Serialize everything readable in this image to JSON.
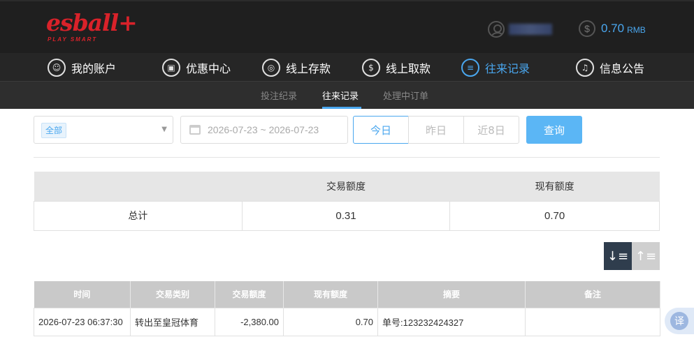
{
  "brand": {
    "logo_main": "esball+",
    "logo_sub": "PLAY SMART"
  },
  "account": {
    "balance": "0.70",
    "currency": "RMB"
  },
  "nav": [
    {
      "label": "我的账户",
      "icon": "user-icon"
    },
    {
      "label": "优惠中心",
      "icon": "gift-icon"
    },
    {
      "label": "线上存款",
      "icon": "deposit-icon"
    },
    {
      "label": "线上取款",
      "icon": "withdraw-icon"
    },
    {
      "label": "往来记录",
      "icon": "records-icon",
      "active": true
    },
    {
      "label": "信息公告",
      "icon": "bell-icon"
    }
  ],
  "subnav": [
    {
      "label": "投注纪录"
    },
    {
      "label": "往来记录",
      "active": true
    },
    {
      "label": "处理中订单"
    }
  ],
  "filters": {
    "category_tag": "全部",
    "date_range": "2026-07-23 ~ 2026-07-23",
    "ranges": [
      "今日",
      "昨日",
      "近8日"
    ],
    "active_range": "今日",
    "query_label": "查询"
  },
  "summary": {
    "headers": [
      "",
      "交易额度",
      "现有额度"
    ],
    "row": [
      "总计",
      "0.31",
      "0.70"
    ]
  },
  "records": {
    "headers": [
      "时间",
      "交易类别",
      "交易额度",
      "现有额度",
      "摘要",
      "备注"
    ],
    "rows": [
      [
        "2026-07-23 06:37:30",
        "转出至皇冠体育",
        "-2,380.00",
        "0.70",
        "单号:123232424327",
        ""
      ]
    ]
  },
  "translate_label": "译",
  "colors": {
    "accent": "#4aa7ef",
    "brand_red": "#d9222a",
    "header_bg": "#1f1f1f"
  }
}
